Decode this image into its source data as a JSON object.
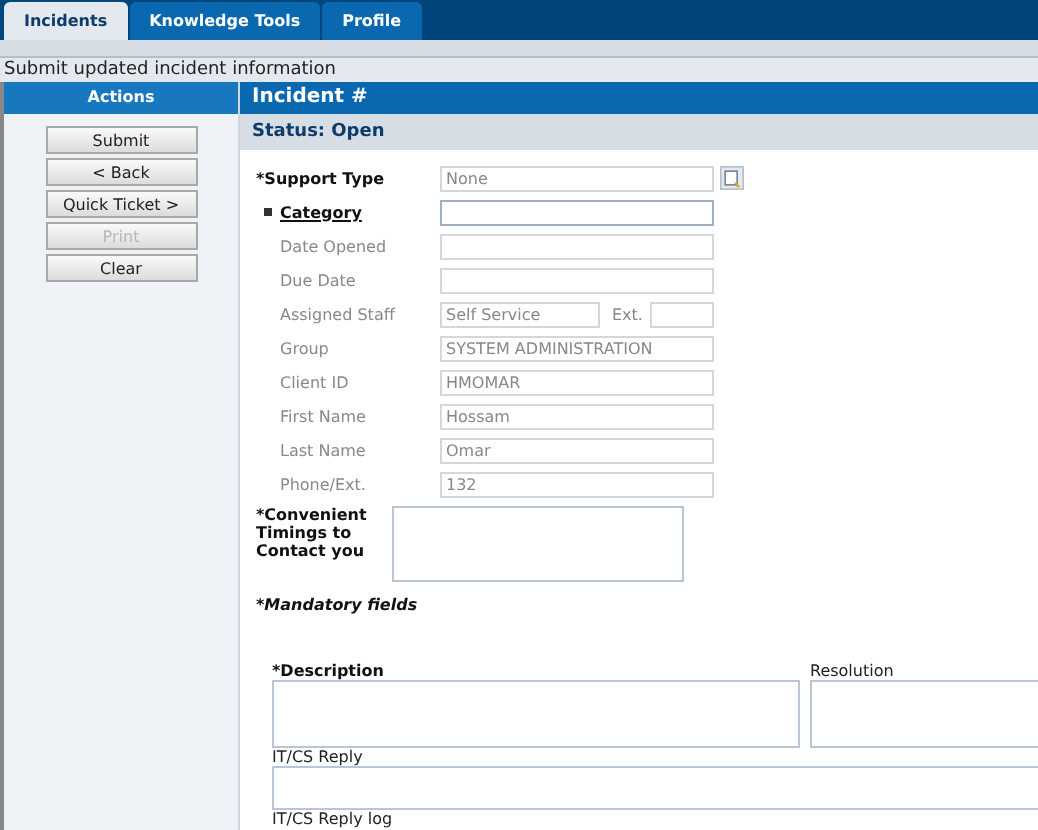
{
  "tabs": [
    {
      "label": "Incidents",
      "selected": true
    },
    {
      "label": "Knowledge Tools",
      "selected": false
    },
    {
      "label": "Profile",
      "selected": false
    }
  ],
  "message": "Submit updated incident information",
  "sidebar": {
    "title": "Actions",
    "buttons": [
      {
        "label": "Submit",
        "disabled": false
      },
      {
        "label": "< Back",
        "disabled": false
      },
      {
        "label": "Quick Ticket >",
        "disabled": false
      },
      {
        "label": "Print",
        "disabled": true
      },
      {
        "label": "Clear",
        "disabled": false
      }
    ]
  },
  "incident": {
    "title": "Incident #",
    "status": "Status: Open"
  },
  "fields": [
    {
      "kind": "required",
      "label": "*Support Type",
      "value": "None",
      "lookup": true
    },
    {
      "kind": "link",
      "label": "Category"
    },
    {
      "kind": "plain",
      "label": "Date Opened"
    },
    {
      "kind": "plain",
      "label": "Due Date"
    },
    {
      "kind": "staff",
      "label": "Assigned Staff",
      "value": "Self Service",
      "ext_label": "Ext."
    },
    {
      "kind": "plain",
      "label": "Group",
      "value": "SYSTEM ADMINISTRATION"
    },
    {
      "kind": "plain",
      "label": "Client ID",
      "value": "HMOMAR"
    },
    {
      "kind": "plain",
      "label": "First Name",
      "value": "Hossam"
    },
    {
      "kind": "plain",
      "label": "Last Name",
      "value": "Omar"
    },
    {
      "kind": "plain",
      "label": "Phone/Ext.",
      "value": "132"
    }
  ],
  "timings": {
    "label": "*Convenient Timings to Contact you"
  },
  "mandatory_note": "*Mandatory fields",
  "description": {
    "label": "*Description"
  },
  "resolution": {
    "label": "Resolution"
  },
  "reply": {
    "label": "IT/CS Reply"
  },
  "reply_log": {
    "label": "IT/CS Reply log"
  }
}
